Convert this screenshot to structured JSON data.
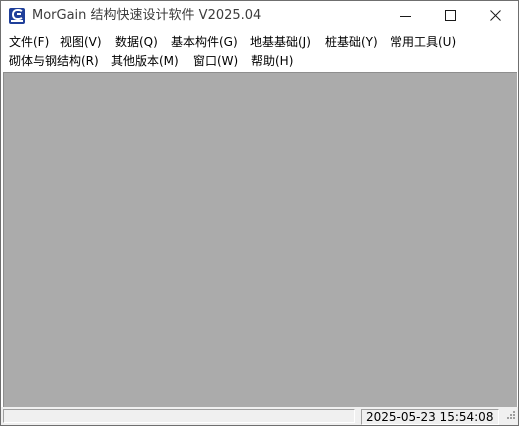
{
  "window": {
    "title": "MorGain 结构快速设计软件 V2025.04",
    "icon": "morgain-app-icon"
  },
  "controls": {
    "minimize_icon": "minimize-icon",
    "maximize_icon": "maximize-icon",
    "close_icon": "close-icon"
  },
  "menu": {
    "row1": [
      {
        "label": "文件(F)"
      },
      {
        "label": "视图(V)"
      },
      {
        "label": "数据(Q)"
      },
      {
        "label": "基本构件(G)"
      },
      {
        "label": "地基基础(J)"
      },
      {
        "label": "桩基础(Y)"
      },
      {
        "label": "常用工具(U)"
      }
    ],
    "row2": [
      {
        "label": "砌体与钢结构(R)"
      },
      {
        "label": "其他版本(M)"
      },
      {
        "label": "窗口(W)"
      },
      {
        "label": "帮助(H)"
      }
    ]
  },
  "statusbar": {
    "left_text": "",
    "datetime": "2025-05-23 15:54:08"
  },
  "colors": {
    "client_area": "#ababab",
    "icon_blue": "#1f3f9a"
  }
}
